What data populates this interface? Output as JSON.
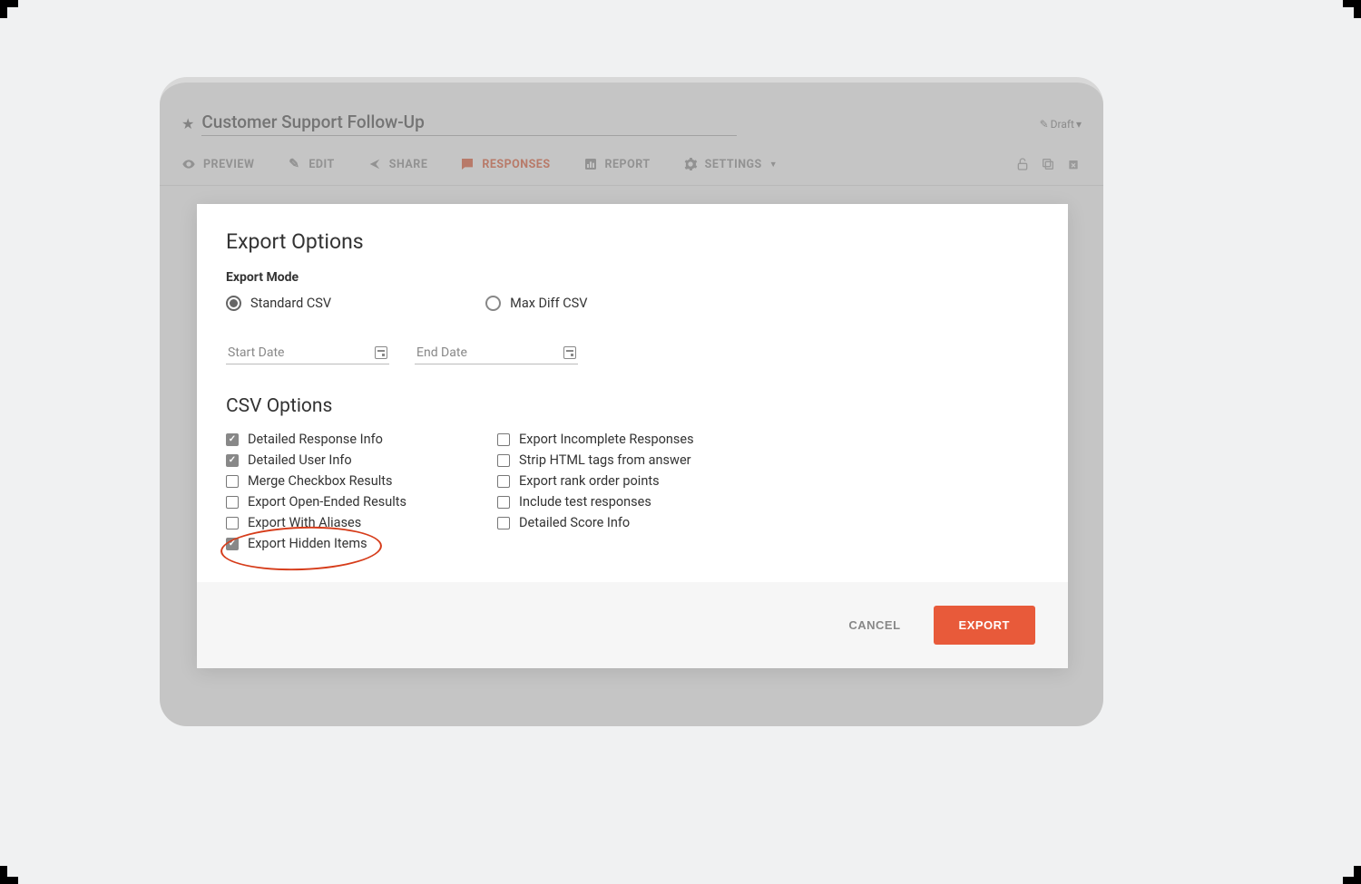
{
  "page": {
    "title": "Customer Support Follow-Up",
    "status_label": "Draft"
  },
  "toolbar": {
    "preview": "PREVIEW",
    "edit": "EDIT",
    "share": "SHARE",
    "responses": "RESPONSES",
    "report": "REPORT",
    "settings": "SETTINGS"
  },
  "modal": {
    "title": "Export Options",
    "mode_label": "Export Mode",
    "mode_standard": "Standard CSV",
    "mode_maxdiff": "Max Diff CSV",
    "start_date_label": "Start Date",
    "end_date_label": "End Date",
    "csv_options_title": "CSV Options",
    "options_left": [
      {
        "label": "Detailed Response Info",
        "checked": true
      },
      {
        "label": "Detailed User Info",
        "checked": true
      },
      {
        "label": "Merge Checkbox Results",
        "checked": false
      },
      {
        "label": "Export Open-Ended Results",
        "checked": false
      },
      {
        "label": "Export With Aliases",
        "checked": false
      },
      {
        "label": "Export Hidden Items",
        "checked": true
      }
    ],
    "options_right": [
      {
        "label": "Export Incomplete Responses",
        "checked": false
      },
      {
        "label": "Strip HTML tags from answer",
        "checked": false
      },
      {
        "label": "Export rank order points",
        "checked": false
      },
      {
        "label": "Include test responses",
        "checked": false
      },
      {
        "label": "Detailed Score Info",
        "checked": false
      }
    ],
    "cancel_label": "CANCEL",
    "export_label": "EXPORT"
  }
}
